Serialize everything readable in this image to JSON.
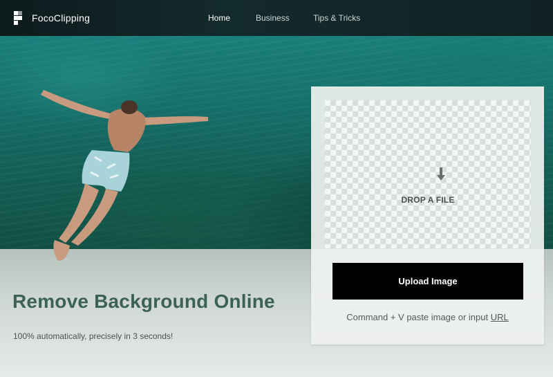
{
  "brand": {
    "name": "FocoClipping",
    "logo_icon": "foco-logo-icon"
  },
  "nav": {
    "items": [
      {
        "label": "Home",
        "active": true
      },
      {
        "label": "Business",
        "active": false
      },
      {
        "label": "Tips & Tricks",
        "active": false
      }
    ]
  },
  "hero": {
    "headline": "Remove Background Online",
    "subline": "100% automatically, precisely in 3 seconds!"
  },
  "upload": {
    "drop_icon": "arrow-down-icon",
    "drop_label": "DROP A FILE",
    "button_label": "Upload Image",
    "paste_hint": "Command + V paste image or input",
    "url_link": "URL"
  },
  "colors": {
    "nav_bg": "#132a2c",
    "headline": "#3c6253",
    "button_bg": "#000000",
    "button_text": "#ffffff"
  }
}
